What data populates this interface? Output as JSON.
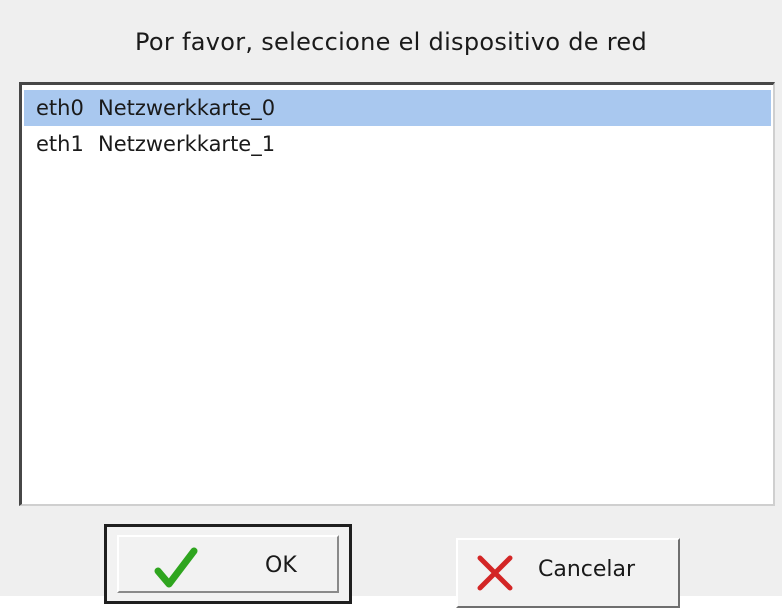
{
  "dialog": {
    "prompt": "Por favor, seleccione el dispositivo de red"
  },
  "network_devices": [
    {
      "device": "eth0",
      "name": "Netzwerkkarte_0",
      "selected": true
    },
    {
      "device": "eth1",
      "name": "Netzwerkkarte_1",
      "selected": false
    }
  ],
  "buttons": {
    "ok": {
      "label": "OK",
      "icon": "checkmark-icon",
      "icon_color": "#2fa51f"
    },
    "cancel": {
      "label": "Cancelar",
      "icon": "cross-icon",
      "icon_color": "#d32626"
    }
  },
  "colors": {
    "selection": "#a9c8ef",
    "dialog_background": "#efefef"
  }
}
